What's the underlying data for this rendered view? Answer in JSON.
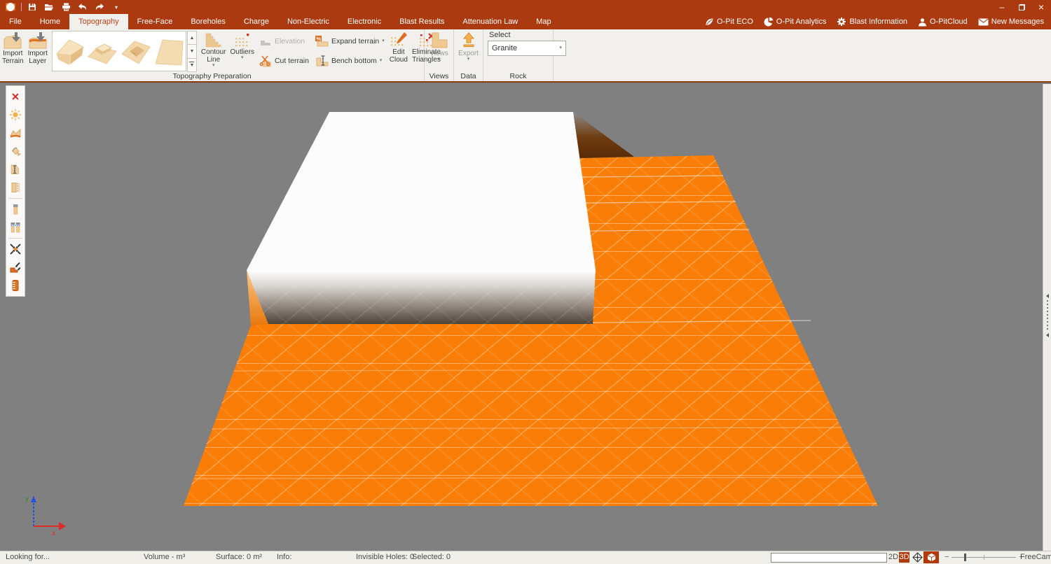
{
  "colors": {
    "accent": "#AC3A10",
    "terrain_orange": "#F97D07",
    "viewport_bg": "#808080",
    "button_tan": "#EFD0A0"
  },
  "titlebar": {
    "window": {
      "minimize": "–",
      "close": "×"
    }
  },
  "tabs": [
    {
      "label": "File"
    },
    {
      "label": "Home"
    },
    {
      "label": "Topography",
      "active": true
    },
    {
      "label": "Free-Face"
    },
    {
      "label": "Boreholes"
    },
    {
      "label": "Charge"
    },
    {
      "label": "Non-Electric"
    },
    {
      "label": "Electronic"
    },
    {
      "label": "Blast Results"
    },
    {
      "label": "Attenuation Law"
    },
    {
      "label": "Map"
    }
  ],
  "services": [
    {
      "label": "O-Pit ECO",
      "icon": "leaf-icon"
    },
    {
      "label": "O-Pit Analytics",
      "icon": "pie-chart-icon"
    },
    {
      "label": "Blast Information",
      "icon": "gear-icon"
    },
    {
      "label": "O-PitCloud",
      "icon": "user-icon"
    },
    {
      "label": "New Messages",
      "icon": "mail-icon"
    }
  ],
  "ribbon": {
    "groups": [
      {
        "label": "Topography Preparation"
      },
      {
        "label": "Views"
      },
      {
        "label": "Data"
      },
      {
        "label": "Rock"
      }
    ],
    "import_terrain": {
      "line1": "Import",
      "line2": "Terrain"
    },
    "import_layer": {
      "line1": "Import",
      "line2": "Layer"
    },
    "contour_line": {
      "line1": "Contour",
      "line2": "Line"
    },
    "outliers": {
      "label": "Outliers"
    },
    "elevation": {
      "label": "Elevation",
      "disabled": true
    },
    "cut_terrain": {
      "label": "Cut terrain"
    },
    "expand_terrain": {
      "label": "Expand terrain"
    },
    "bench_bottom": {
      "label": "Bench bottom"
    },
    "edit_cloud": {
      "line1": "Edit",
      "line2": "Cloud"
    },
    "eliminate_triangles": {
      "line1": "Eliminate",
      "line2": "Triangles"
    },
    "views_button": {
      "label": "Views"
    },
    "export_button": {
      "label": "Export"
    },
    "rock": {
      "select_label": "Select",
      "value": "Granite"
    }
  },
  "icons": {
    "caret": "▾",
    "gallery_up": "▲",
    "gallery_down": "▼",
    "gallery_more": "▼",
    "expand_percent": "%"
  },
  "statusbar": {
    "looking": "Looking for...",
    "volume": "Volume - m³",
    "surface": "Surface: 0 m²",
    "info": "Info:",
    "invisible_holes": "Invisible Holes: 0",
    "selected": "Selected: 0",
    "search_value": "",
    "mode_2d": "2D",
    "mode_3d": "3D",
    "zoom_minus": "−",
    "zoom_plus": "+",
    "freecam": "FreeCam"
  },
  "viewport": {
    "axis_x_label": "x",
    "axis_y_label": "y"
  }
}
